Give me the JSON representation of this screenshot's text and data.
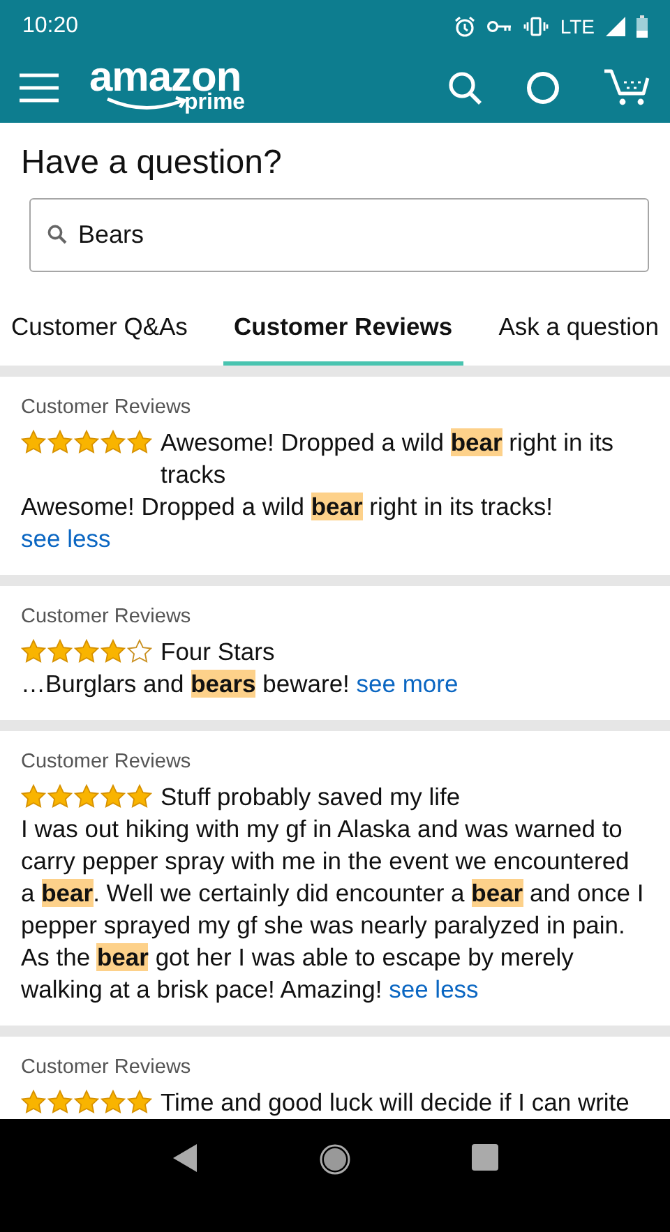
{
  "status_bar": {
    "time": "10:20",
    "network": "LTE"
  },
  "header": {
    "logo": "amazon",
    "logo_sub": "prime"
  },
  "question": {
    "title": "Have a question?",
    "search_value": "Bears"
  },
  "tabs": [
    {
      "label": "Customer Q&As",
      "selected": false
    },
    {
      "label": "Customer Reviews",
      "selected": true
    },
    {
      "label": "Ask a question",
      "selected": false
    }
  ],
  "reviews": [
    {
      "label": "Customer Reviews",
      "stars": 5,
      "title": "Awesome! Dropped a wild **bear** right in its tracks",
      "body": "Awesome! Dropped a wild **bear** right in its tracks!",
      "link": "see less"
    },
    {
      "label": "Customer Reviews",
      "stars": 4,
      "title": "Four Stars",
      "body": "…Burglars and **bears** beware!",
      "link": "see more"
    },
    {
      "label": "Customer Reviews",
      "stars": 5,
      "title": "Stuff probably saved my life",
      "body": "I was out hiking with my gf in Alaska and was warned to carry pepper spray with me in the event we encountered a **bear**. Well we certainly did encounter a **bear** and once I pepper sprayed my gf she was nearly paralyzed in pain. As the **bear** got her I was able to escape by merely walking at a brisk pace! Amazing!",
      "link": "see less"
    },
    {
      "label": "Customer Reviews",
      "stars": 5,
      "title": "Time and good luck will decide if I can write"
    }
  ]
}
